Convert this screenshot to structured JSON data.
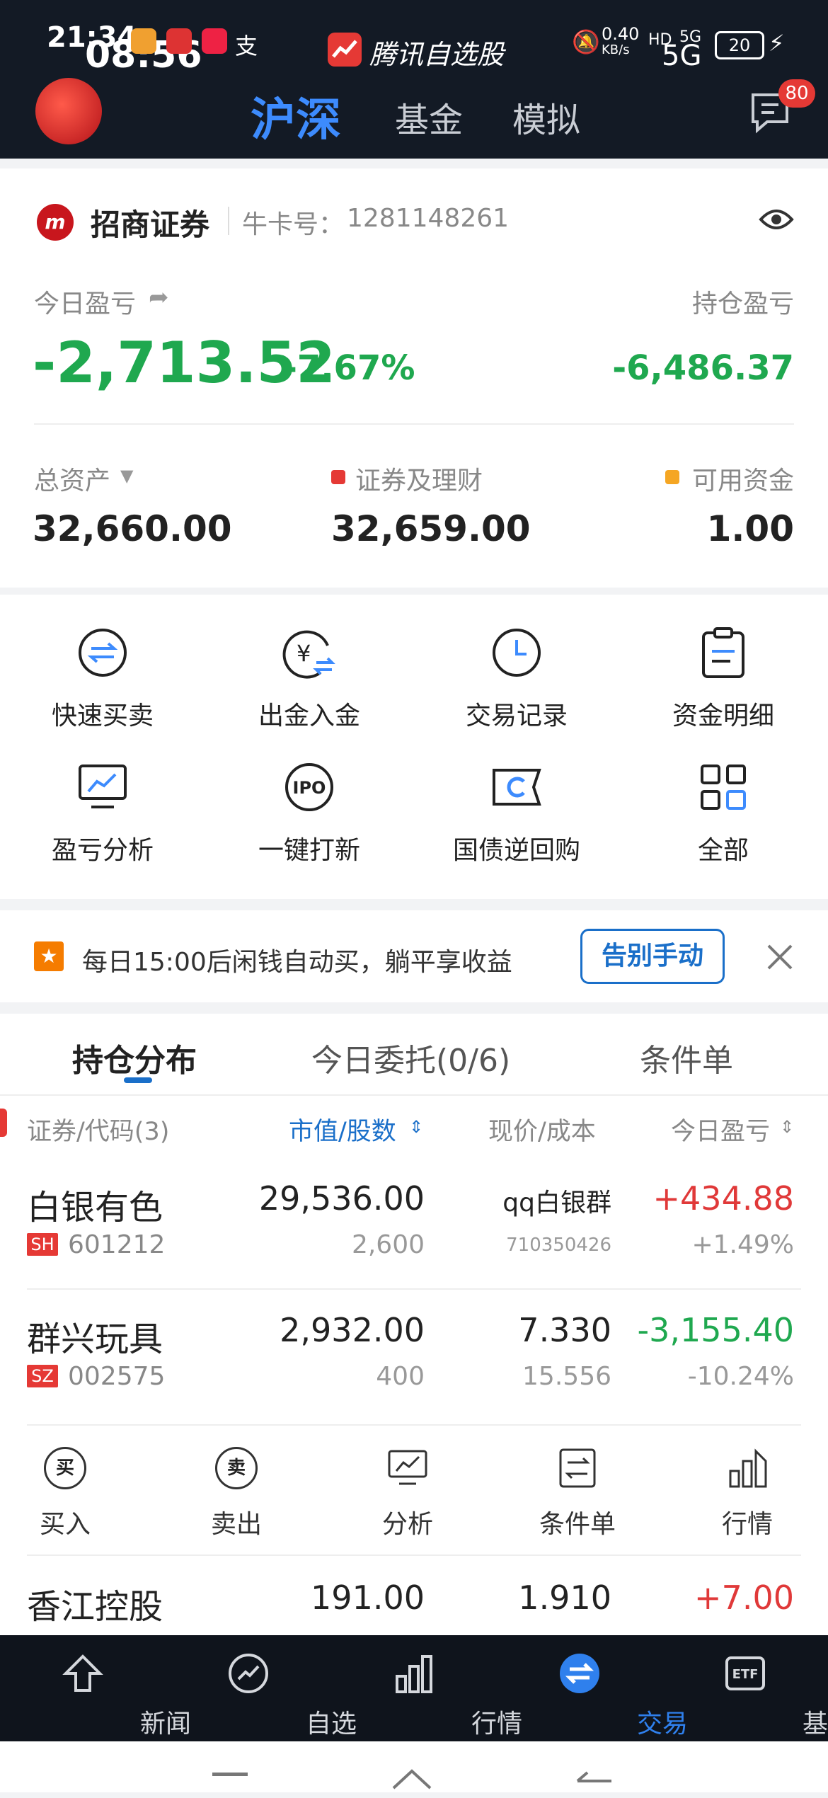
{
  "status_bar": {
    "time": "21:34",
    "overlay_time": "08:56",
    "app_name": "腾讯自选股",
    "network_speed": "0.40",
    "network_unit": "KB/s",
    "sim_1": "HD",
    "sim_2": "5G",
    "battery": "20",
    "signal_label": "5G"
  },
  "header": {
    "tabs": [
      "沪深",
      "基金",
      "模拟"
    ],
    "active_tab": 0,
    "message_badge": "80"
  },
  "account": {
    "broker": "招商证券",
    "card_label": "牛卡号：",
    "card_number": "1281148261"
  },
  "pnl": {
    "today_label": "今日盈亏",
    "today_value": "-2,713.52",
    "today_pct": "-7.67%",
    "hold_label": "持仓盈亏",
    "hold_value": "-6,486.37"
  },
  "assets": {
    "total_label": "总资产",
    "total_value": "32,660.00",
    "securities_label": "证券及理财",
    "securities_value": "32,659.00",
    "cash_label": "可用资金",
    "cash_value": "1.00",
    "securities_color": "#e53935",
    "cash_color": "#f5a623"
  },
  "shortcuts": [
    "快速买卖",
    "出金入金",
    "交易记录",
    "资金明细",
    "盈亏分析",
    "一键打新",
    "国债逆回购",
    "全部"
  ],
  "banner": {
    "text": "每日15:00后闲钱自动买，躺平享收益",
    "button": "告别手动"
  },
  "holdings_tabs": [
    "持仓分布",
    "今日委托(0/6)",
    "条件单"
  ],
  "columns": {
    "security": "证券/代码(3)",
    "value": "市值/股数",
    "price": "现价/成本",
    "pnl": "今日盈亏"
  },
  "holdings": [
    {
      "name": "白银有色",
      "market": "SH",
      "code": "601212",
      "value": "29,536.00",
      "shares": "2,600",
      "price": "qq白银群",
      "cost": "710350426",
      "pnl": "+434.88",
      "pnl_pct": "+1.49%"
    },
    {
      "name": "群兴玩具",
      "market": "SZ",
      "code": "002575",
      "value": "2,932.00",
      "shares": "400",
      "price": "7.330",
      "cost": "15.556",
      "pnl": "-3,155.40",
      "pnl_pct": "-10.24%"
    },
    {
      "name": "香江控股",
      "value": "191.00",
      "price": "1.910",
      "pnl": "+7.00"
    }
  ],
  "row_actions": [
    "买入",
    "卖出",
    "分析",
    "条件单",
    "行情"
  ],
  "bottom_nav": [
    "新闻",
    "自选",
    "行情",
    "交易",
    "基金"
  ],
  "bottom_nav_active": 3,
  "buy_glyph": "买",
  "sell_glyph": "卖",
  "ipo_glyph": "IPO",
  "etf_glyph": "ETF",
  "yen_glyph": "¥"
}
